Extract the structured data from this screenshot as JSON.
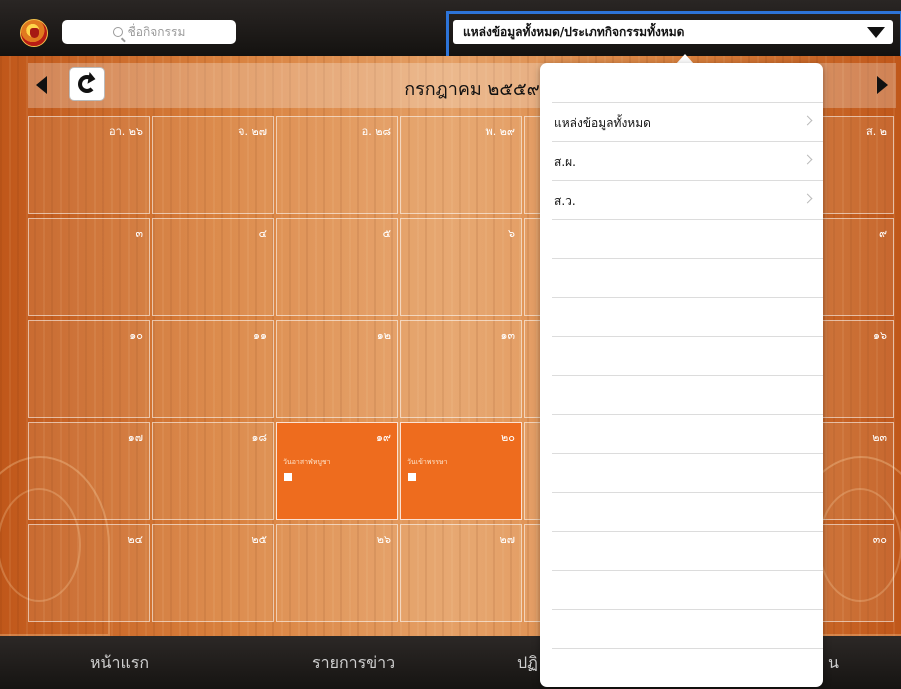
{
  "header": {
    "search_placeholder": "ชื่อกิจกรรม",
    "filter_label": "แหล่งข้อมูลทั้งหมด/ประเภทกิจกรรมทั้งหมด"
  },
  "calendar": {
    "month_title": "กรกฎาคม ๒๕๕๙",
    "rows": [
      [
        {
          "day": "อา. ๒๖"
        },
        {
          "day": "จ. ๒๗"
        },
        {
          "day": "อ. ๒๘"
        },
        {
          "day": "พ. ๒๙"
        },
        {
          "day": ""
        },
        {
          "day": ""
        },
        {
          "day": "ส. ๒"
        }
      ],
      [
        {
          "day": "๓"
        },
        {
          "day": "๔"
        },
        {
          "day": "๕"
        },
        {
          "day": "๖"
        },
        {
          "day": ""
        },
        {
          "day": ""
        },
        {
          "day": "๙"
        }
      ],
      [
        {
          "day": "๑๐"
        },
        {
          "day": "๑๑"
        },
        {
          "day": "๑๒"
        },
        {
          "day": "๑๓"
        },
        {
          "day": ""
        },
        {
          "day": ""
        },
        {
          "day": "๑๖"
        }
      ],
      [
        {
          "day": "๑๗"
        },
        {
          "day": "๑๘"
        },
        {
          "day": "๑๙",
          "event": "วันอาสาฬหบูชา"
        },
        {
          "day": "๒๐",
          "event": "วันเข้าพรรษา"
        },
        {
          "day": ""
        },
        {
          "day": ""
        },
        {
          "day": "๒๓"
        }
      ],
      [
        {
          "day": "๒๔"
        },
        {
          "day": "๒๕"
        },
        {
          "day": "๒๖"
        },
        {
          "day": "๒๗"
        },
        {
          "day": ""
        },
        {
          "day": ""
        },
        {
          "day": "๓๐"
        }
      ]
    ]
  },
  "dropdown": {
    "items": [
      {
        "label": "แหล่งข้อมูลทั้งหมด"
      },
      {
        "label": "ส.ผ."
      },
      {
        "label": "ส.ว."
      }
    ],
    "empty_rows": 11
  },
  "tabs": [
    {
      "label": "หน้าแรก"
    },
    {
      "label": "รายการข่าว"
    },
    {
      "label": "ปฏิ"
    },
    {
      "label": "น"
    }
  ]
}
